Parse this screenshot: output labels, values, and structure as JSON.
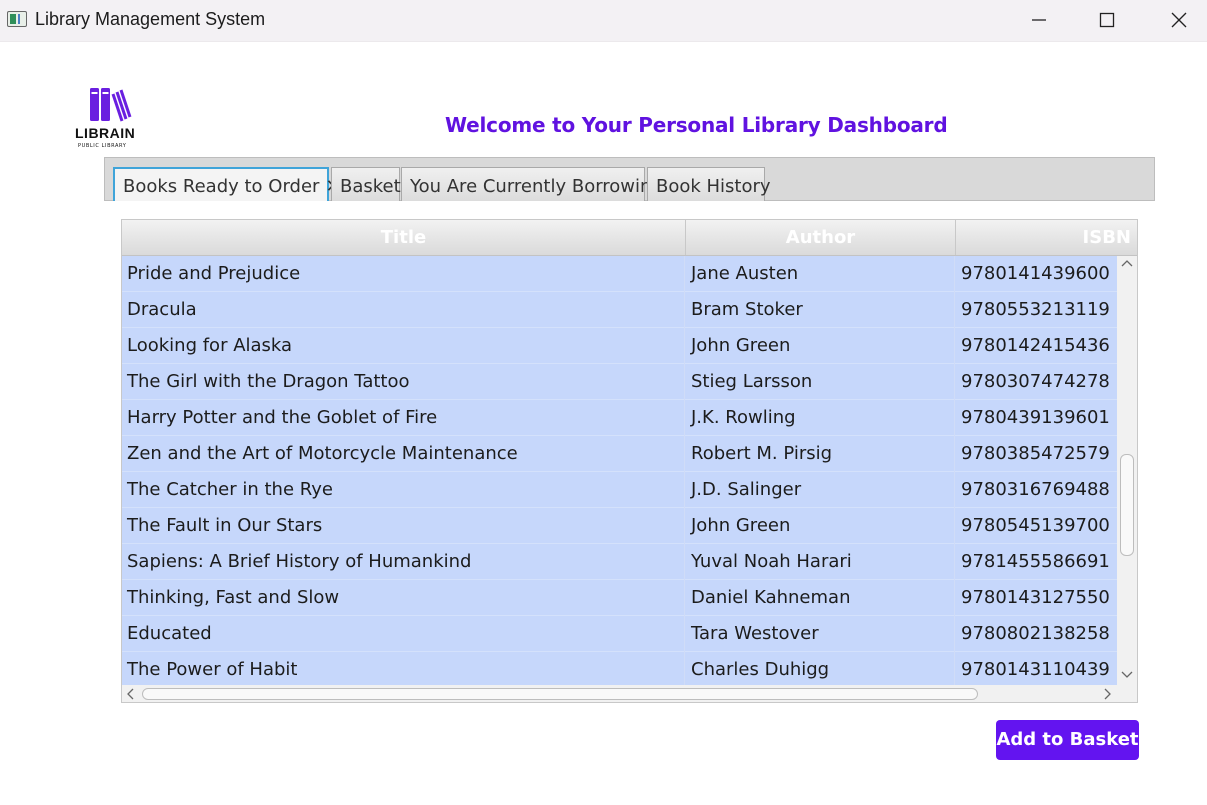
{
  "window": {
    "title": "Library Management System"
  },
  "logo": {
    "name": "LIBRAIN",
    "subtitle": "PUBLIC LIBRARY",
    "color": "#6a1fe0"
  },
  "header": {
    "title": "Welcome to Your Personal Library Dashboard",
    "title_color": "#6012e0"
  },
  "tabs": [
    {
      "label": "Books Ready to Order",
      "active": true,
      "closable": true
    },
    {
      "label": "Basket",
      "active": false
    },
    {
      "label": "You Are Currently Borrowing",
      "active": false
    },
    {
      "label": "Book History",
      "active": false
    }
  ],
  "table": {
    "columns": [
      "Title",
      "Author",
      "ISBN"
    ],
    "rows": [
      {
        "title": "Pride and Prejudice",
        "author": "Jane Austen",
        "isbn": "9780141439600"
      },
      {
        "title": "Dracula",
        "author": "Bram Stoker",
        "isbn": "9780553213119"
      },
      {
        "title": "Looking for Alaska",
        "author": "John Green",
        "isbn": "9780142415436"
      },
      {
        "title": "The Girl with the Dragon Tattoo",
        "author": "Stieg Larsson",
        "isbn": "9780307474278"
      },
      {
        "title": "Harry Potter and the Goblet of Fire",
        "author": "J.K. Rowling",
        "isbn": "9780439139601"
      },
      {
        "title": "Zen and the Art of Motorcycle Maintenance",
        "author": "Robert M. Pirsig",
        "isbn": "9780385472579"
      },
      {
        "title": "The Catcher in the Rye",
        "author": "J.D. Salinger",
        "isbn": "9780316769488"
      },
      {
        "title": "The Fault in Our Stars",
        "author": "John Green",
        "isbn": "9780545139700"
      },
      {
        "title": "Sapiens: A Brief History of Humankind",
        "author": "Yuval Noah Harari",
        "isbn": "9781455586691"
      },
      {
        "title": "Thinking, Fast and Slow",
        "author": "Daniel Kahneman",
        "isbn": "9780143127550"
      },
      {
        "title": "Educated",
        "author": "Tara Westover",
        "isbn": "9780802138258"
      },
      {
        "title": "The Power of Habit",
        "author": "Charles Duhigg",
        "isbn": "9780143110439"
      }
    ],
    "selection_color": "#c6d7fb"
  },
  "actions": {
    "add_to_basket": "Add to Basket",
    "button_color": "#6314f0"
  }
}
